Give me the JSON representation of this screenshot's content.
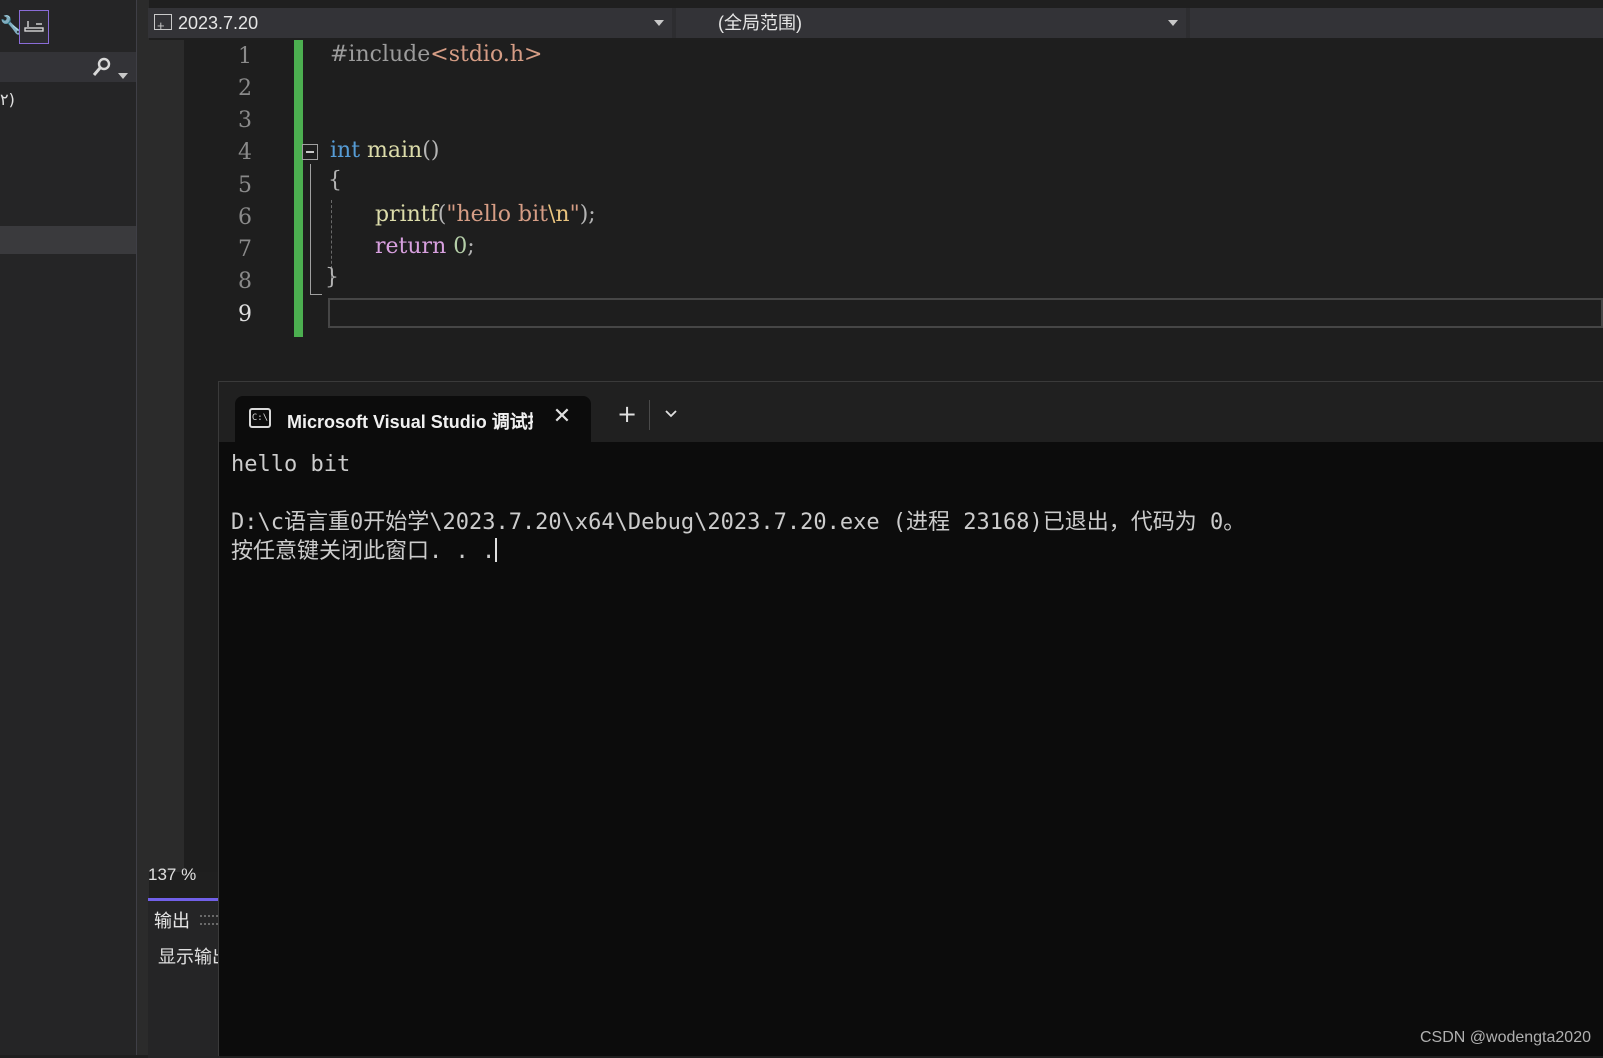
{
  "nav_bar": {
    "project": "2023.7.20",
    "scope": "(全局范围)",
    "member": ""
  },
  "left_panel": {
    "tree_item_fragment": "۲)"
  },
  "editor": {
    "line_numbers": [
      "1",
      "2",
      "3",
      "4",
      "5",
      "6",
      "7",
      "8",
      "9"
    ],
    "code": {
      "l1_directive": "#include",
      "l1_header": "<stdio.h>",
      "l4_type": "int",
      "l4_func": " main",
      "l4_parens": "()",
      "l5": "{",
      "l6_func": "printf",
      "l6_open": "(",
      "l6_str": "\"hello bit",
      "l6_esc": "\\n",
      "l6_quote": "\"",
      "l6_close": ");",
      "l7_kw": "return",
      "l7_num": "0",
      "l7_semi": ";",
      "l8": "}"
    },
    "zoom": "137 %"
  },
  "output_panel": {
    "title": "输出",
    "source_label": "显示输出"
  },
  "console": {
    "tab_title": "Microsoft Visual Studio 调试控制台",
    "icon_text": "C:\\",
    "lines": {
      "l1": "hello bit",
      "l2": "",
      "l3": "D:\\c语言重0开始学\\2023.7.20\\x64\\Debug\\2023.7.20.exe (进程 23168)已退出，代码为 0。",
      "l4": "按任意键关闭此窗口. . ."
    }
  },
  "watermark": "CSDN @wodengta2020",
  "colors": {
    "change_bar": "#4caf50",
    "accent": "#7160e8",
    "keyword": "#569cd6",
    "control_keyword": "#d8a0df",
    "function": "#dcdcaa",
    "string": "#d69d85"
  }
}
